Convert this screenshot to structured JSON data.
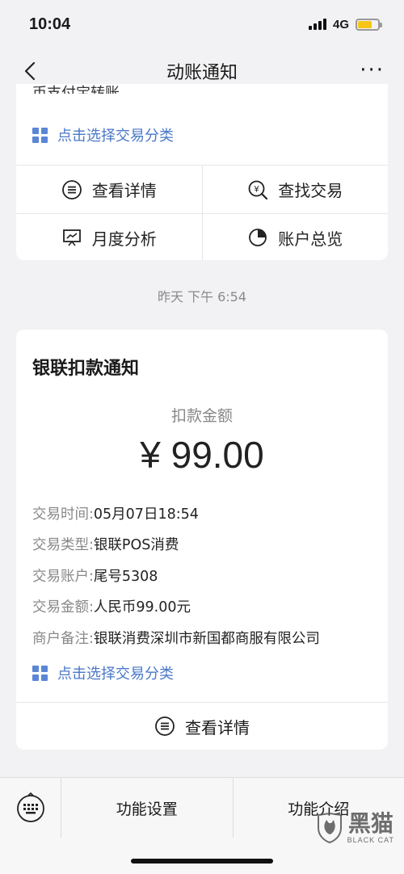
{
  "status_bar": {
    "time": "10:04",
    "network": "4G",
    "battery_color": "#f5c518"
  },
  "nav": {
    "title": "动账通知",
    "back_icon": "chevron-left-icon",
    "more_label": "···"
  },
  "card1": {
    "cut_text": "币支付宝转账",
    "category_label": "点击选择交易分类",
    "actions": [
      {
        "label": "查看详情",
        "icon": "list-circle-icon"
      },
      {
        "label": "查找交易",
        "icon": "search-yen-icon"
      },
      {
        "label": "月度分析",
        "icon": "chart-board-icon"
      },
      {
        "label": "账户总览",
        "icon": "pie-chart-icon"
      }
    ]
  },
  "timestamp": "昨天 下午 6:54",
  "notice": {
    "title": "银联扣款通知",
    "amount_label": "扣款金额",
    "amount_value": "¥ 99.00",
    "details": [
      {
        "key": "交易时间:",
        "value": "05月07日18:54"
      },
      {
        "key": "交易类型:",
        "value": "银联POS消费"
      },
      {
        "key": "交易账户:",
        "value": "尾号5308"
      },
      {
        "key": "交易金额:",
        "value": "人民币99.00元"
      },
      {
        "key": "商户备注:",
        "value": "银联消费深圳市新国都商服有限公司"
      }
    ],
    "category_label": "点击选择交易分类",
    "footer_label": "查看详情"
  },
  "bottom_bar": {
    "menu_items": [
      "功能设置",
      "功能介绍"
    ],
    "keyboard_icon": "keyboard-icon"
  },
  "watermark": {
    "cn": "黑猫",
    "en": "BLACK CAT"
  },
  "colors": {
    "accent_blue": "#4a78c8",
    "background": "#f2f2f4"
  }
}
